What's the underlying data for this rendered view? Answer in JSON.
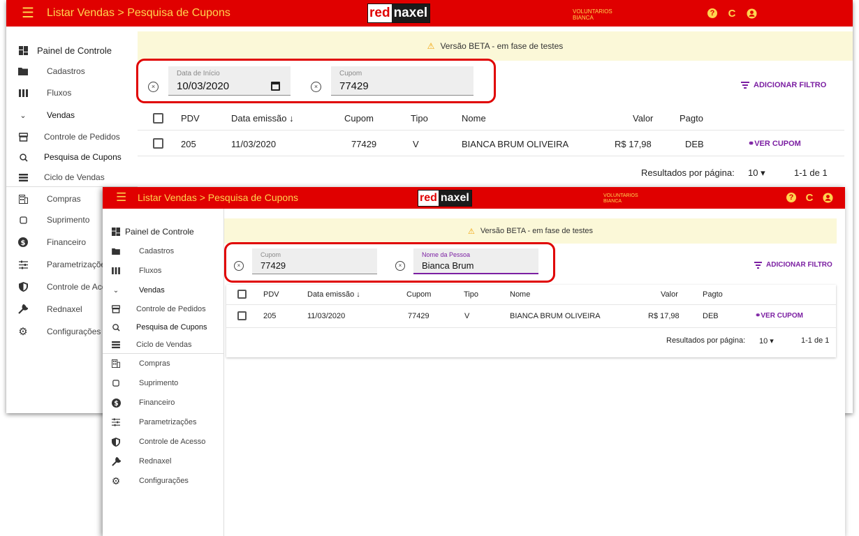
{
  "app": {
    "title": "Listar Vendas > Pesquisa de Cupons",
    "logo_red": "red",
    "logo_black": "naxel",
    "user_line1": "VOLUNTARIOS",
    "user_line2": "BIANCA",
    "icons": [
      "help-icon",
      "refresh-icon",
      "account-icon"
    ],
    "colors": {
      "topbar": "#e00000",
      "accent": "#7b1fa2",
      "topbar_text": "#ffd54f",
      "beta_bg": "#fbf8d8",
      "highlight": "#e00000"
    }
  },
  "sidebar": {
    "items": [
      {
        "label": "Painel de Controle",
        "icon": "dashboard-icon"
      },
      {
        "label": "Cadastros",
        "icon": "folder-icon"
      },
      {
        "label": "Fluxos",
        "icon": "columns-icon"
      },
      {
        "label": "Vendas",
        "icon": "chevron-down-icon"
      },
      {
        "label": "Controle de Pedidos",
        "icon": "store-icon"
      },
      {
        "label": "Pesquisa de Cupons",
        "icon": "search-receipt-icon"
      },
      {
        "label": "Ciclo de Vendas",
        "icon": "list-icon"
      },
      {
        "label": "Compras",
        "icon": "building-icon"
      },
      {
        "label": "Suprimento",
        "icon": "box-icon"
      },
      {
        "label": "Financeiro",
        "icon": "dollar-icon"
      },
      {
        "label": "Parametrizações",
        "icon": "sliders-icon"
      },
      {
        "label": "Controle de Acesso",
        "icon": "shield-icon"
      },
      {
        "label": "Rednaxel",
        "icon": "wrench-icon"
      },
      {
        "label": "Configurações",
        "icon": "gear-icon"
      }
    ],
    "w1_truncated": {
      "parametrizacoes": "Parametrizaçõe",
      "controle_acesso": "Controle de Ace"
    }
  },
  "beta_text": "Versão BETA - em fase de testes",
  "add_filter": "ADICIONAR FILTRO",
  "window1": {
    "filters": [
      {
        "label": "Data de Início",
        "value": "10/03/2020"
      },
      {
        "label": "Cupom",
        "value": "77429"
      }
    ]
  },
  "window2": {
    "filters": [
      {
        "label": "Cupom",
        "value": "77429"
      },
      {
        "label": "Nome da Pessoa",
        "value": "Bianca Brum"
      }
    ]
  },
  "table": {
    "headers": [
      "PDV",
      "Data emissão ↓",
      "Cupom",
      "Tipo",
      "Nome",
      "Valor",
      "Pagto"
    ],
    "rows": [
      {
        "pdv": "205",
        "data": "11/03/2020",
        "cupom": "77429",
        "tipo": "V",
        "nome": "BIANCA BRUM OLIVEIRA",
        "valor": "R$ 17,98",
        "pagto": "DEB",
        "action": "VER CUPOM"
      }
    ],
    "footer": {
      "per_page_label": "Resultados por página:",
      "per_page": "10",
      "range": "1-1 de 1"
    }
  }
}
